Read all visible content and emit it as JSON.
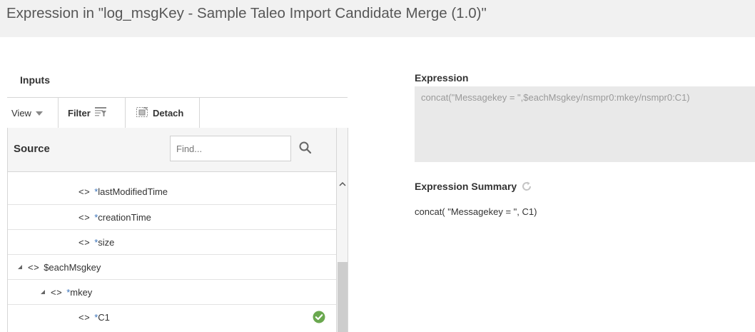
{
  "header": {
    "title": "Expression in \"log_msgKey - Sample Taleo Import Candidate Merge (1.0)\""
  },
  "inputs": {
    "label": "Inputs",
    "toolbar": {
      "view_label": "View",
      "filter_label": "Filter",
      "detach_label": "Detach"
    },
    "source_label": "Source",
    "find_placeholder": "Find...",
    "tree": [
      {
        "tag": "<>",
        "star": "*",
        "name": "lastModifiedTime",
        "level": 3,
        "expander": false,
        "checked": false
      },
      {
        "tag": "<>",
        "star": "*",
        "name": "creationTime",
        "level": 3,
        "expander": false,
        "checked": false
      },
      {
        "tag": "<>",
        "star": "*",
        "name": "size",
        "level": 3,
        "expander": false,
        "checked": false
      },
      {
        "tag": "<>",
        "star": "",
        "name": "$eachMsgkey",
        "level": 1,
        "expander": true,
        "checked": false
      },
      {
        "tag": "<>",
        "star": "*",
        "name": "mkey",
        "level": 2,
        "expander": true,
        "checked": false
      },
      {
        "tag": "<>",
        "star": "*",
        "name": "C1",
        "level": 3,
        "expander": false,
        "checked": true
      }
    ]
  },
  "expression": {
    "label": "Expression",
    "value": "concat(\"Messagekey = \",$eachMsgkey/nsmpr0:mkey/nsmpr0:C1)"
  },
  "summary": {
    "label": "Expression Summary",
    "value": "concat( \"Messagekey = \", C1)"
  },
  "colors": {
    "header_bg": "#f1f1f1",
    "check_green": "#6aa84f",
    "star_blue": "#3b73b9",
    "expression_bg": "#e9e9e9"
  }
}
